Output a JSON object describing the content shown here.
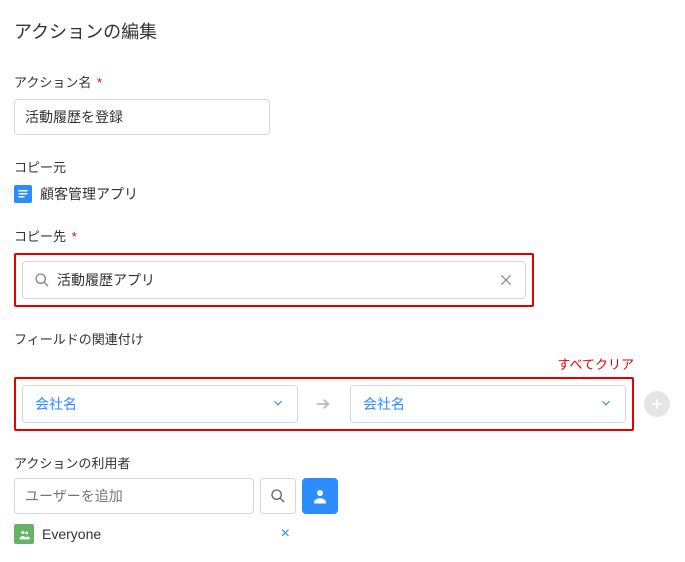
{
  "title": "アクションの編集",
  "action_name": {
    "label": "アクション名",
    "required": "*",
    "value": "活動履歴を登録"
  },
  "copy_from": {
    "label": "コピー元",
    "app_name": "顧客管理アプリ"
  },
  "copy_to": {
    "label": "コピー先",
    "required": "*",
    "value": "活動履歴アプリ"
  },
  "mapping": {
    "section_label": "フィールドの関連付け",
    "clear_all": "すべてクリア",
    "left_field": "会社名",
    "right_field": "会社名"
  },
  "users": {
    "section_label": "アクションの利用者",
    "placeholder": "ユーザーを追加",
    "chip": "Everyone"
  }
}
